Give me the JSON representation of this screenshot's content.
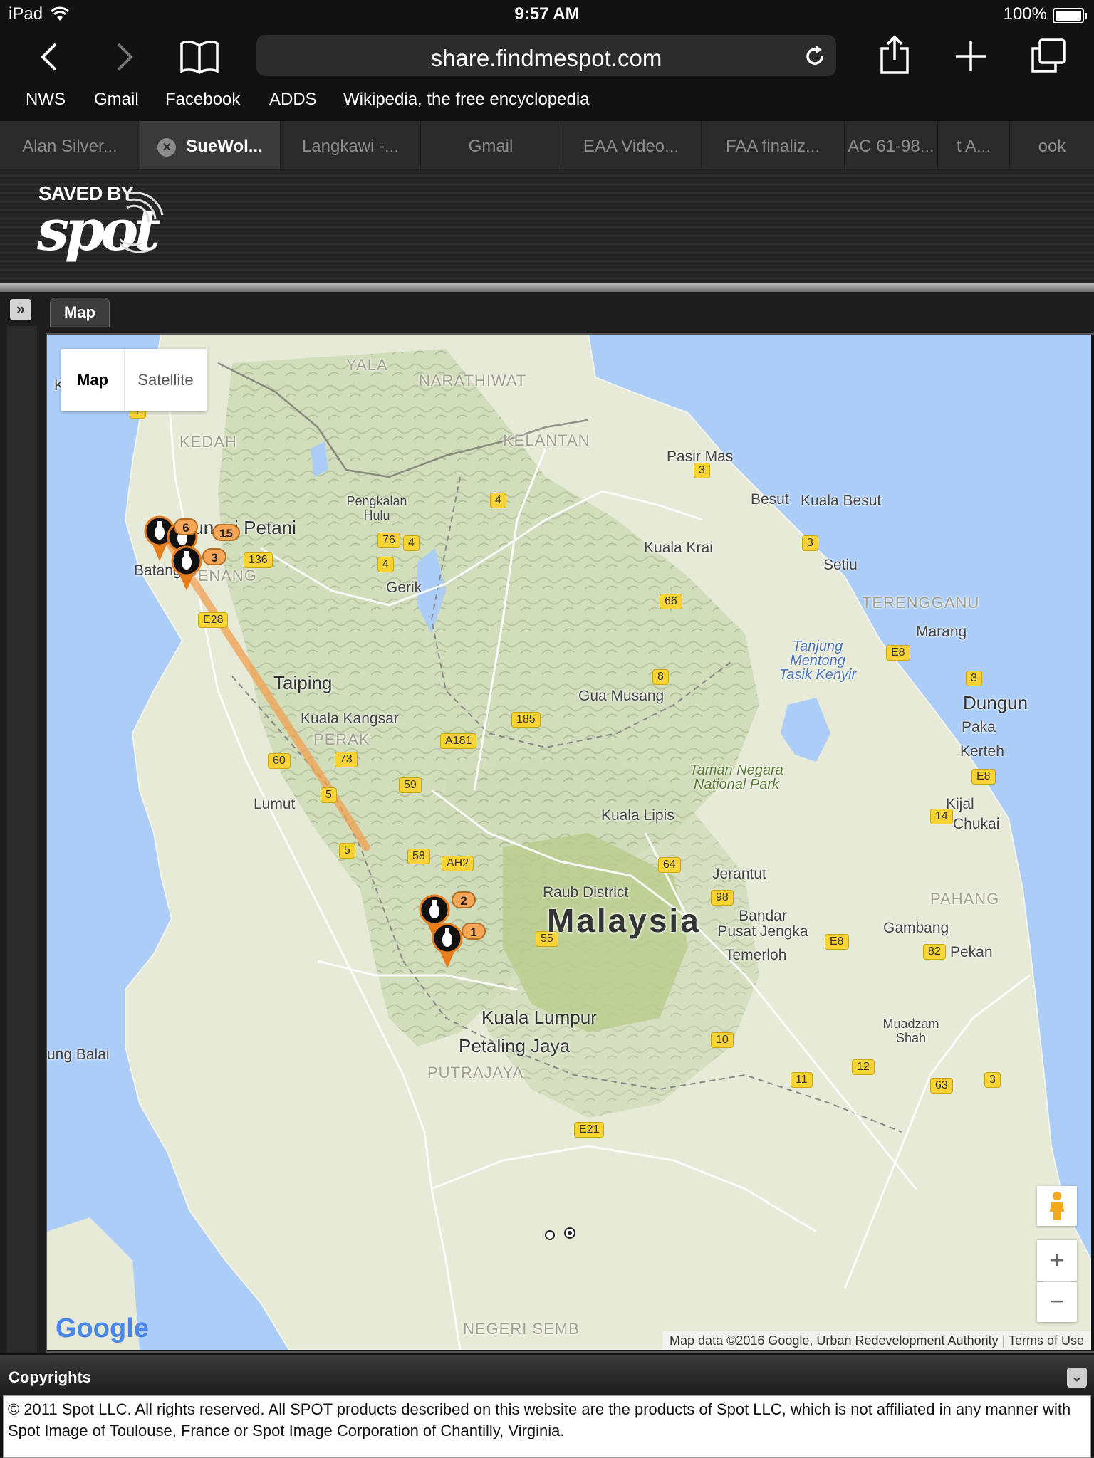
{
  "status_bar": {
    "device": "iPad",
    "time": "9:57 AM",
    "battery": "100%",
    "battery_level": 1.0
  },
  "browser": {
    "url": "share.findmespot.com",
    "bookmarks": [
      "NWS",
      "Gmail",
      "Facebook",
      "ADDS",
      "Wikipedia, the free encyclopedia"
    ],
    "tabs": [
      {
        "label": "Alan Silver..."
      },
      {
        "label": "SueWol...",
        "active": true
      },
      {
        "label": "Langkawi -..."
      },
      {
        "label": "Gmail"
      },
      {
        "label": "EAA Video..."
      },
      {
        "label": "FAA finaliz..."
      },
      {
        "label": "AC 61-98..."
      },
      {
        "label": "t A..."
      },
      {
        "label": "ook"
      }
    ]
  },
  "header": {
    "logo_top": "SAVED BY",
    "logo_main": "spot"
  },
  "panel": {
    "tab_label": "Map",
    "toggle_icon": "double-chevron-right-icon"
  },
  "map": {
    "type_buttons": {
      "map": "Map",
      "satellite": "Satellite"
    },
    "zoom_in": "+",
    "zoom_out": "−",
    "google": "Google",
    "attribution": "Map data ©2016 Google, Urban Redevelopment Authority",
    "terms": "Terms of Use",
    "country_label": "Malaysia",
    "regions": [
      "YALA",
      "NARATHIWAT",
      "KEDAH",
      "KELANTAN",
      "TERENGGANU",
      "PERAK",
      "PAHANG",
      "PUTRAJAYA",
      "PENANG",
      "NEGERI SEMB"
    ],
    "places": [
      "Pasir Mas",
      "Besut",
      "Kuala Besut",
      "Pengkalan Hulu",
      "Sungai Petani",
      "Kuala Krai",
      "Setiu",
      "Gerik",
      "Marang",
      "Tanjung Mentong Tasik Kenyir",
      "Taiping",
      "Gua Musang",
      "Dungun",
      "Kuala Kangsar",
      "Paka",
      "Kerteh",
      "Taman Negara National Park",
      "Lumut",
      "Kuala Lipis",
      "Kijal",
      "Chukai",
      "Jerantut",
      "Raub District",
      "Bandar Pusat Jengka",
      "Gambang",
      "Temerloh",
      "Pekan",
      "Kuala Lumpur",
      "Petaling Jaya",
      "Muadzam Shah",
      "ung Balai",
      "Kuah",
      "Batang"
    ],
    "road_shields": [
      "7",
      "3",
      "4",
      "4",
      "76",
      "4",
      "136",
      "3",
      "E28",
      "66",
      "8",
      "E8",
      "3",
      "185",
      "A181",
      "60",
      "73",
      "5",
      "59",
      "E8",
      "14",
      "5",
      "58",
      "AH2",
      "64",
      "98",
      "55",
      "E8",
      "82",
      "10",
      "12",
      "11",
      "63",
      "3",
      "E21"
    ],
    "marker_counts": [
      "6",
      "15",
      "3",
      "2",
      "1"
    ],
    "accent_orange": "#f5a657",
    "track_color": "#f0a050"
  },
  "footer": {
    "title": "Copyrights",
    "collapse_icon": "double-chevron-down-icon",
    "text": "© 2011 Spot LLC. All rights reserved. All SPOT products described on this website are the products of Spot LLC, which is not affiliated in any manner with Spot Image of Toulouse, France or Spot Image Corporation of Chantilly, Virginia."
  }
}
